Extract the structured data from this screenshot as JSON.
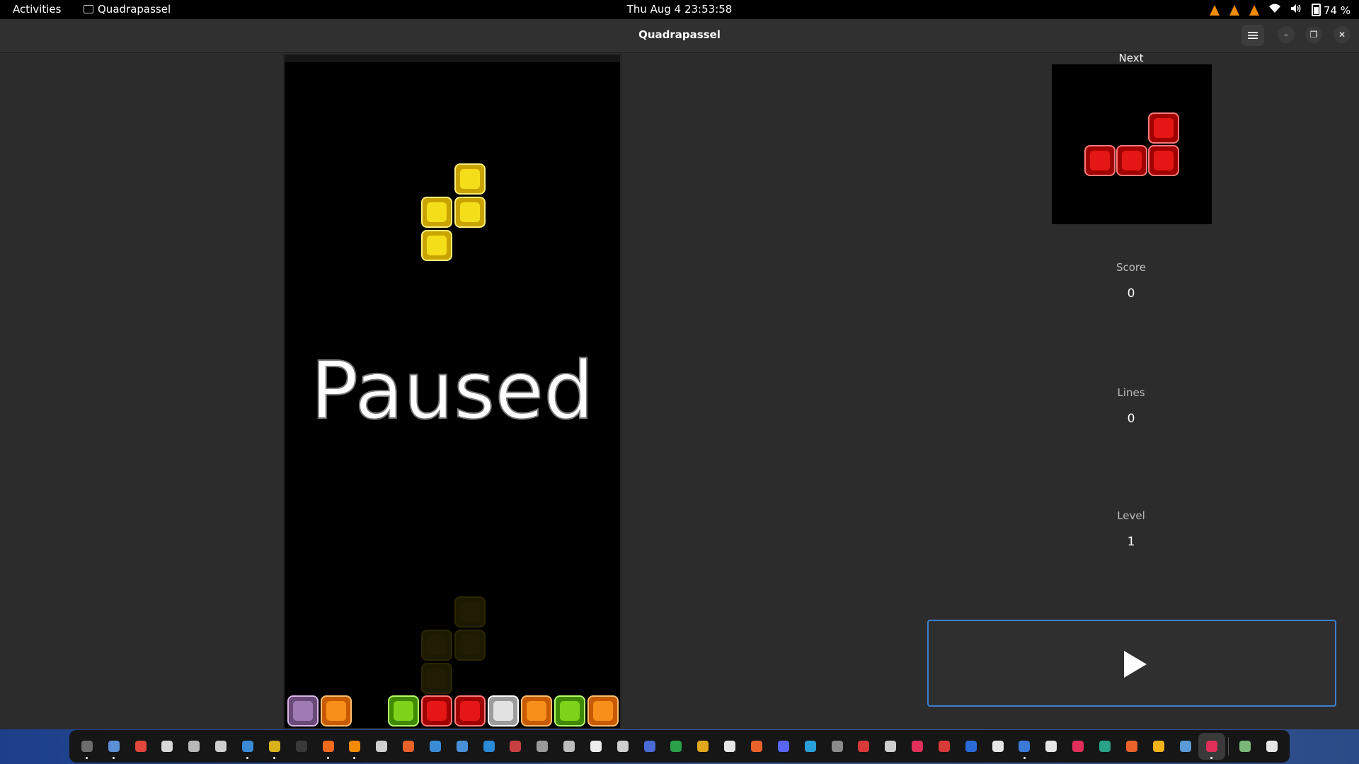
{
  "topbar": {
    "activities": "Activities",
    "app_name": "Quadrapassel",
    "datetime": "Thu Aug 4  23:53:58",
    "battery": "74 %"
  },
  "window": {
    "title": "Quadrapassel"
  },
  "game": {
    "paused_text": "Paused",
    "next_label": "Next",
    "score_label": "Score",
    "score": "0",
    "lines_label": "Lines",
    "lines": "0",
    "level_label": "Level",
    "level": "1"
  },
  "dock": {
    "items": [
      {
        "name": "system-monitor-icon",
        "color": "#6d6d6d",
        "running": true
      },
      {
        "name": "files-icon",
        "color": "#5b8fd6",
        "running": true
      },
      {
        "name": "chrome-icon",
        "color": "#e0463b",
        "running": false
      },
      {
        "name": "document-viewer-icon",
        "color": "#d8d8d8",
        "running": false
      },
      {
        "name": "text-editor-icon",
        "color": "#b8b8b8",
        "running": false
      },
      {
        "name": "screenshot-icon",
        "color": "#cfcfcf",
        "running": false
      },
      {
        "name": "writer-icon",
        "color": "#3a8ad6",
        "running": true
      },
      {
        "name": "calc-icon",
        "color": "#d8b21a",
        "running": true
      },
      {
        "name": "terminal-icon",
        "color": "#3a3a3a",
        "running": false
      },
      {
        "name": "firefox-icon",
        "color": "#f06a1e",
        "running": true
      },
      {
        "name": "vlc-icon",
        "color": "#f28a00",
        "running": true
      },
      {
        "name": "obs-icon",
        "color": "#cfcfcf",
        "running": false
      },
      {
        "name": "software-center-icon",
        "color": "#e8622a",
        "running": false
      },
      {
        "name": "notes-icon",
        "color": "#3a8ad6",
        "running": false
      },
      {
        "name": "docs-icon",
        "color": "#4a90d9",
        "running": false
      },
      {
        "name": "help-icon",
        "color": "#2a8ad6",
        "running": false
      },
      {
        "name": "activity-monitor-icon",
        "color": "#c84040",
        "running": false
      },
      {
        "name": "webcam-icon",
        "color": "#9a9a9a",
        "running": false
      },
      {
        "name": "drone-icon",
        "color": "#bdbdbd",
        "running": false
      },
      {
        "name": "inkscape-icon",
        "color": "#ededed",
        "running": false
      },
      {
        "name": "box-icon",
        "color": "#cfcfcf",
        "running": false
      },
      {
        "name": "camera-icon",
        "color": "#4a6ad6",
        "running": false
      },
      {
        "name": "spreadsheet-icon",
        "color": "#2aa24a",
        "running": false
      },
      {
        "name": "slides-icon",
        "color": "#e0a81a",
        "running": false
      },
      {
        "name": "music-icon",
        "color": "#e6e6e6",
        "running": false
      },
      {
        "name": "presentation-icon",
        "color": "#e8622a",
        "running": false
      },
      {
        "name": "discord-icon",
        "color": "#5865f2",
        "running": false
      },
      {
        "name": "telegram-icon",
        "color": "#2aa1da",
        "running": false
      },
      {
        "name": "settings-icon",
        "color": "#8a8a8a",
        "running": false
      },
      {
        "name": "pdf-icon",
        "color": "#d83a3a",
        "running": false
      },
      {
        "name": "percent-icon",
        "color": "#cfcfcf",
        "running": false
      },
      {
        "name": "recorder-icon",
        "color": "#e0305a",
        "running": false
      },
      {
        "name": "calendar-icon",
        "color": "#d83a3a",
        "running": false
      },
      {
        "name": "word-icon",
        "color": "#2a6ad6",
        "running": false
      },
      {
        "name": "atom-icon",
        "color": "#e6e6e6",
        "running": false
      },
      {
        "name": "word-alt-icon",
        "color": "#3a7ad6",
        "running": true
      },
      {
        "name": "clock-icon",
        "color": "#e6e6e6",
        "running": false
      },
      {
        "name": "cards-icon",
        "color": "#e0305a",
        "running": false
      },
      {
        "name": "shell-icon",
        "color": "#2aa28a",
        "running": false
      },
      {
        "name": "game-icon",
        "color": "#e8622a",
        "running": false
      },
      {
        "name": "chat-icon",
        "color": "#f0b41a",
        "running": false
      },
      {
        "name": "remote-icon",
        "color": "#5a9ad6",
        "running": false
      },
      {
        "name": "quadrapassel-icon",
        "color": "#e0305a",
        "running": true,
        "active": true
      },
      {
        "name": "trash-icon",
        "color": "#7ab87a",
        "running": false
      },
      {
        "name": "show-apps-icon",
        "color": "#e6e6e6",
        "running": false
      }
    ]
  }
}
